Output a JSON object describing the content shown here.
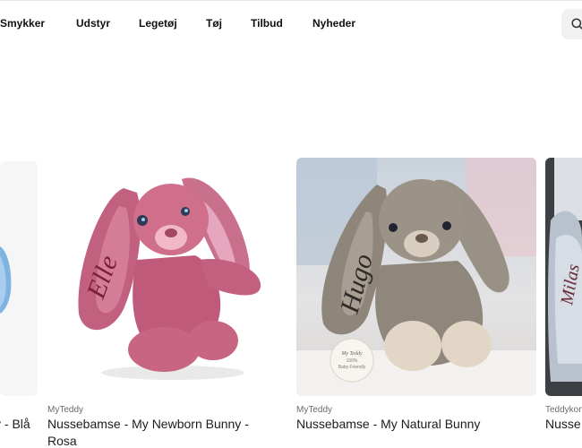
{
  "nav": {
    "items": [
      "Smykker",
      "Udstyr",
      "Legetøj",
      "Tøj",
      "Tilbud",
      "Nyheder"
    ]
  },
  "search": {
    "icon": "search-icon"
  },
  "products": [
    {
      "brand": "",
      "title": "y - Blå"
    },
    {
      "brand": "MyTeddy",
      "title": "Nussebamse - My Newborn Bunny - Rosa",
      "embroidery": "Elle"
    },
    {
      "brand": "MyTeddy",
      "title": "Nussebamse - My Natural Bunny",
      "embroidery": "Hugo",
      "tag": [
        "My Teddy",
        "100%",
        "Baby Friendly"
      ]
    },
    {
      "brand": "Teddykom",
      "title": "Nusse",
      "embroidery": "Milas"
    }
  ],
  "colors": {
    "nav_text": "#111111",
    "brand_text": "#6a6a6a",
    "title_text": "#1c1c1c",
    "search_bg": "#f1f1f1"
  }
}
